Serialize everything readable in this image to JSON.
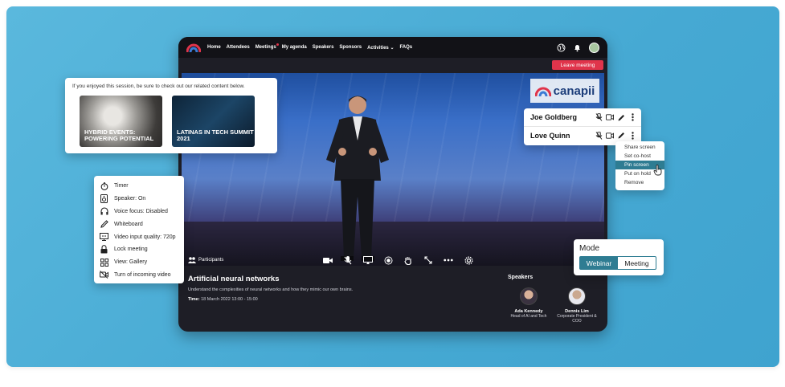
{
  "nav": {
    "links": [
      "Home",
      "Attendees",
      "Meetings",
      "My agenda",
      "Speakers",
      "Sponsors",
      "Activities",
      "FAQs"
    ],
    "icons": [
      "globe-icon",
      "bell-icon",
      "avatar"
    ]
  },
  "leave_label": "Leave meeting",
  "brand": "canapii",
  "participants_label": "Participants",
  "session": {
    "title": "Artificial neural networks",
    "description": "Understand the complexities of neural networks and how they mimic our own brains.",
    "time_label": "Time:",
    "time_value": "18 March 2022 13:00 - 15:00"
  },
  "speakers": {
    "label": "Speakers",
    "items": [
      {
        "name": "Ada Kennedy",
        "role": "Head of AI and Tech"
      },
      {
        "name": "Dennis Lim",
        "role": "Corporate President & COO"
      }
    ]
  },
  "related": {
    "text": "If you enjoyed this session, be sure to check out our related content below.",
    "items": [
      {
        "title": "HYBRID EVENTS: POWERING POTENTIAL"
      },
      {
        "title": "LATINAS IN TECH SUMMIT 2021"
      }
    ]
  },
  "menu": [
    {
      "icon": "timer-icon",
      "label": "Timer"
    },
    {
      "icon": "speaker-icon",
      "label": "Speaker: On"
    },
    {
      "icon": "headphones-icon",
      "label": "Voice focus: Disabled"
    },
    {
      "icon": "pencil-icon",
      "label": "Whiteboard"
    },
    {
      "icon": "monitor-icon",
      "label": "Video input quality: 720p"
    },
    {
      "icon": "lock-icon",
      "label": "Lock meeting"
    },
    {
      "icon": "grid-icon",
      "label": "View: Gallery"
    },
    {
      "icon": "video-off-icon",
      "label": "Turn of incoming video"
    }
  ],
  "participants": [
    {
      "name": "Joe Goldberg"
    },
    {
      "name": "Love Quinn"
    }
  ],
  "context_menu": [
    "Share screen",
    "Set co-host",
    "Pin screen",
    "Put on hold",
    "Remove"
  ],
  "context_active_index": 2,
  "mode": {
    "label": "Mode",
    "options": [
      "Webinar",
      "Meeting"
    ],
    "selected": "Webinar"
  },
  "colors": {
    "accent": "#2e7c92",
    "leave": "#e0344b",
    "background": "#4aaed6"
  }
}
